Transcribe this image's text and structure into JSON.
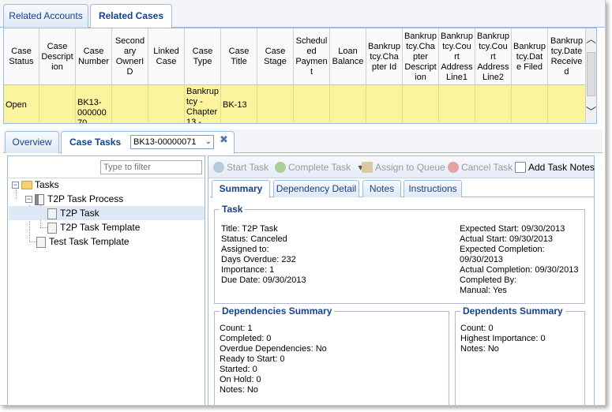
{
  "top_tabs": [
    {
      "label": "Related Accounts",
      "active": false
    },
    {
      "label": "Related Cases",
      "active": true
    }
  ],
  "grid": {
    "columns": [
      "Case Status",
      "Case Description",
      "Case Number",
      "Secondary OwnerID",
      "Linked Case",
      "Case Type",
      "Case Title",
      "Case Stage",
      "Scheduled Payment",
      "Loan Balance",
      "Bankruptcy.Chapter Id",
      "Bankruptcy.Chapter Description",
      "Bankruptcy.Court Address Line1",
      "Bankruptcy.Court Address Line2",
      "Bankruptcy.Date Filed",
      "Bankruptcy.Date Received"
    ],
    "column_headers_display": [
      "Case\nStatus",
      "Case\nDescript\nion",
      "Case\nNumber",
      "Second\nary\nOwnerI\nD",
      "Linked\nCase",
      "Case\nType",
      "Case\nTitle",
      "Case\nStage",
      "Schedul\ned\nPaymen\nt",
      "Loan\nBalance",
      "Bankrup\ntcy.Cha\npter Id",
      "Bankrup\ntcy.Cha\npter\nDescript\nion",
      "Bankrup\ntcy.Cou\nrt\nAddress\nLine1",
      "Bankrup\ntcy.Cou\nrt\nAddress\nLine2",
      "Bankrup\ntcy.Dat\ne Filed",
      "Bankrup\ntcy.Date\nReceive\nd"
    ],
    "row": {
      "status": "Open",
      "description": "",
      "number": "BK13-\n000000\n70",
      "secondary_owner": "",
      "linked_case": "",
      "type": "Bankrup\ntcy -\nChapter\n13 -",
      "title": "BK-13",
      "stage": "",
      "scheduled_payment": "",
      "loan_balance": "",
      "chapter_id": "",
      "chapter_desc": "",
      "addr1": "",
      "addr2": "",
      "date_filed": "",
      "date_received": ""
    },
    "highlight_color": "#fbf39d"
  },
  "lower_tabs": [
    {
      "label": "Overview",
      "active": false
    },
    {
      "label": "Case Tasks",
      "active": true
    }
  ],
  "case_selector": {
    "value": "BK13-00000071",
    "arrow": "⌄",
    "close": "✖"
  },
  "tree": {
    "filter_placeholder": "Type to filter",
    "nodes": [
      {
        "label": "Tasks",
        "type": "folder",
        "expander": "−"
      },
      {
        "label": "T2P Task Process",
        "type": "process",
        "expander": "−"
      },
      {
        "label": "T2P Task",
        "type": "doc",
        "selected": true
      },
      {
        "label": "T2P Task Template",
        "type": "doc"
      },
      {
        "label": "Test Task Template",
        "type": "doc"
      }
    ]
  },
  "toolbar": {
    "start": "Start Task",
    "complete": "Complete Task",
    "assign": "Assign to Queue",
    "cancel": "Cancel Task",
    "add_notes": "Add Task Notes",
    "dropdown_arrow": "▾"
  },
  "sub_tabs": [
    {
      "label": "Summary",
      "active": true
    },
    {
      "label": "Dependency Detail",
      "active": false
    },
    {
      "label": "Notes",
      "active": false
    },
    {
      "label": "Instructions",
      "active": false
    }
  ],
  "task": {
    "legend": "Task",
    "left": [
      "Title: T2P Task",
      "Status: Canceled",
      "Assigned to:",
      "Days Overdue: 232",
      "Importance: 1",
      "Due Date: 09/30/2013"
    ],
    "right": [
      "Expected Start: 09/30/2013",
      "Actual Start: 09/30/2013",
      "Expected Completion:",
      "09/30/2013",
      "Actual Completion: 09/30/2013",
      "Completed By:",
      "Manual: Yes"
    ]
  },
  "dependencies": {
    "legend": "Dependencies Summary",
    "lines": [
      "Count: 1",
      "Completed: 0",
      "Overdue Dependencies: No",
      "Ready to Start: 0",
      "Started: 0",
      "On Hold: 0",
      "Notes: No"
    ]
  },
  "dependents": {
    "legend": "Dependents Summary",
    "lines": [
      "Count: 0",
      "Highest Importance: 0",
      "Notes: No"
    ]
  }
}
